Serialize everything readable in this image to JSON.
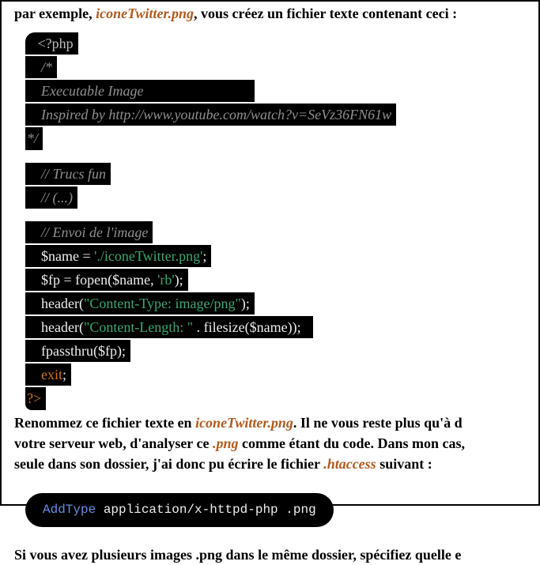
{
  "intro": {
    "pre": "par exemple, ",
    "file": "iconeTwitter.png",
    "post": ", vous créez un fichier texte contenant ceci :"
  },
  "code1": {
    "l0": "   <?php",
    "l1": "    /*",
    "l2": "    Executable Image                              ",
    "l3": "    Inspired by http://www.youtube.com/watch?v=SeVz36FN61w",
    "l4": "*/",
    "l5": "    // Trucs fun",
    "l6": "    // (...)",
    "l7": "    // Envoi de l'image",
    "l8a": "    $name = ",
    "l8b": "'./iconeTwitter.png'",
    "l8c": ";",
    "l9a": "    $fp = fopen($name, ",
    "l9b": "'rb'",
    "l9c": ");",
    "l10a": "    header(",
    "l10b": "\"Content-Type: image/png\"",
    "l10c": ");",
    "l11a": "    header(",
    "l11b": "\"Content-Length: \"",
    "l11c": " . filesize($name));  ",
    "l12": "    fpassthru($fp);",
    "l13a": "    ",
    "l13b": "exit",
    "l13c": ";",
    "l14": "?>"
  },
  "mid": {
    "t1": "Renommez ce fichier texte en ",
    "file": "iconeTwitter.png",
    "t2": ". Il ne vous reste plus qu'à d",
    "t3": "votre serveur web, d'analyser ce ",
    "ext": ".png",
    "t4": " comme étant du code. Dans mon cas, ",
    "t5": "seule dans son dossier, j'ai donc pu écrire le fichier ",
    "ht": ".htaccess",
    "t6": " suivant :"
  },
  "code2": {
    "kw": "AddType",
    "rest": " application/x-httpd-php .png"
  },
  "outro": "Si vous avez plusieurs images .png dans le même dossier, spécifiez quelle e"
}
